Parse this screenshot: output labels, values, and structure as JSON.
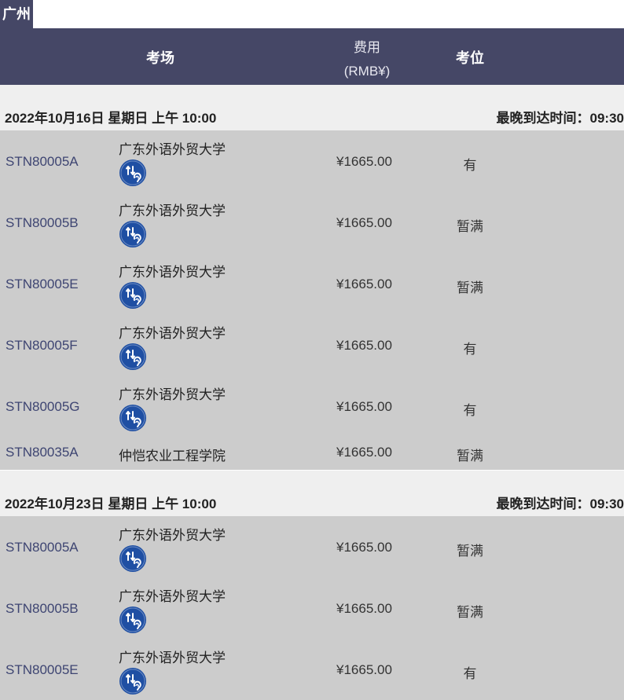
{
  "city": "广州",
  "header": {
    "venue": "考场",
    "fee_line1": "费用",
    "fee_line2": "(RMB¥)",
    "seat": "考位"
  },
  "colors": {
    "header_bg": "#454766",
    "session_bg": "#efefef",
    "row_bg": "#cccccc",
    "code_text": "#3e4572",
    "icon_blue": "#1f4fa3"
  },
  "icon_name": "hearing-headphones-icon",
  "sessions": [
    {
      "date": "2022年10月16日 星期日 上午 10:00",
      "arrive": "最晚到达时间：09:30",
      "rows": [
        {
          "code": "STN80005A",
          "venue": "广东外语外贸大学",
          "fee": "¥1665.00",
          "seat": "有",
          "icon": true
        },
        {
          "code": "STN80005B",
          "venue": "广东外语外贸大学",
          "fee": "¥1665.00",
          "seat": "暂满",
          "icon": true
        },
        {
          "code": "STN80005E",
          "venue": "广东外语外贸大学",
          "fee": "¥1665.00",
          "seat": "暂满",
          "icon": true
        },
        {
          "code": "STN80005F",
          "venue": "广东外语外贸大学",
          "fee": "¥1665.00",
          "seat": "有",
          "icon": true
        },
        {
          "code": "STN80005G",
          "venue": "广东外语外贸大学",
          "fee": "¥1665.00",
          "seat": "有",
          "icon": true
        },
        {
          "code": "STN80035A",
          "venue": "仲恺农业工程学院",
          "fee": "¥1665.00",
          "seat": "暂满",
          "icon": false
        }
      ]
    },
    {
      "date": "2022年10月23日 星期日 上午 10:00",
      "arrive": "最晚到达时间：09:30",
      "rows": [
        {
          "code": "STN80005A",
          "venue": "广东外语外贸大学",
          "fee": "¥1665.00",
          "seat": "暂满",
          "icon": true
        },
        {
          "code": "STN80005B",
          "venue": "广东外语外贸大学",
          "fee": "¥1665.00",
          "seat": "暂满",
          "icon": true
        },
        {
          "code": "STN80005E",
          "venue": "广东外语外贸大学",
          "fee": "¥1665.00",
          "seat": "有",
          "icon": true
        }
      ]
    }
  ]
}
